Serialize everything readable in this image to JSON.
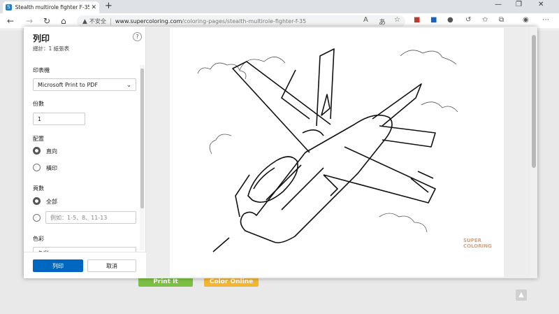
{
  "browser": {
    "tab_title": "Stealth multirole fighter F-35 co",
    "tab_favicon": "S",
    "new_tab": "+",
    "address": {
      "warning_label": "不安全",
      "host": "www.supercoloring.com",
      "path": "/coloring-pages/stealth-multirole-fighter-f-35"
    }
  },
  "page": {
    "print_it_label": "Print It",
    "color_online_label": "Color Online",
    "print_it_color": "#7cc043",
    "color_online_color": "#f2b632"
  },
  "print_dialog": {
    "title": "列印",
    "subtitle": "總計：1 紙張表",
    "help": "?",
    "printer_label": "印表機",
    "printer_value": "Microsoft Print to PDF",
    "copies_label": "份數",
    "copies_value": "1",
    "layout_label": "配置",
    "layout_portrait": "直向",
    "layout_landscape": "橫印",
    "pages_label": "頁數",
    "pages_all": "全部",
    "pages_range_placeholder": "例如：1-5、8、11-13",
    "color_label": "色彩",
    "color_value": "色彩",
    "print_button": "列印",
    "cancel_button": "取消",
    "accent": "#0067c0"
  },
  "preview": {
    "watermark": "SUPER COLORING"
  }
}
